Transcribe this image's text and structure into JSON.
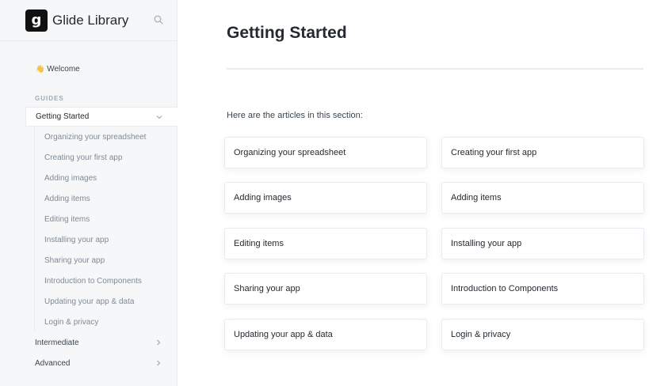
{
  "sidebar": {
    "brand_title": "Glide Library",
    "logo_letter": "g",
    "welcome": {
      "emoji": "👋",
      "label": "Welcome"
    },
    "guides_label": "GUIDES",
    "getting_started": "Getting Started",
    "sub_items": [
      "Organizing your spreadsheet",
      "Creating your first app",
      "Adding images",
      "Adding items",
      "Editing items",
      "Installing your app",
      "Sharing your app",
      "Introduction to Components",
      "Updating your app & data",
      "Login & privacy"
    ],
    "intermediate": "Intermediate",
    "advanced": "Advanced"
  },
  "main": {
    "title": "Getting Started",
    "intro": "Here are the articles in this section:",
    "cards": [
      "Organizing your spreadsheet",
      "Creating your first app",
      "Adding images",
      "Adding items",
      "Editing items",
      "Installing your app",
      "Sharing your app",
      "Introduction to Components",
      "Updating your app & data",
      "Login & privacy"
    ]
  },
  "icons": {
    "search": "search-icon",
    "chevron_down": "chevron-down-icon",
    "chevron_right": "chevron-right-icon"
  },
  "colors": {
    "sidebar_bg": "#f5f7f9",
    "border": "#e6ecf1",
    "text": "#242a31",
    "muted": "#7d8b97"
  }
}
